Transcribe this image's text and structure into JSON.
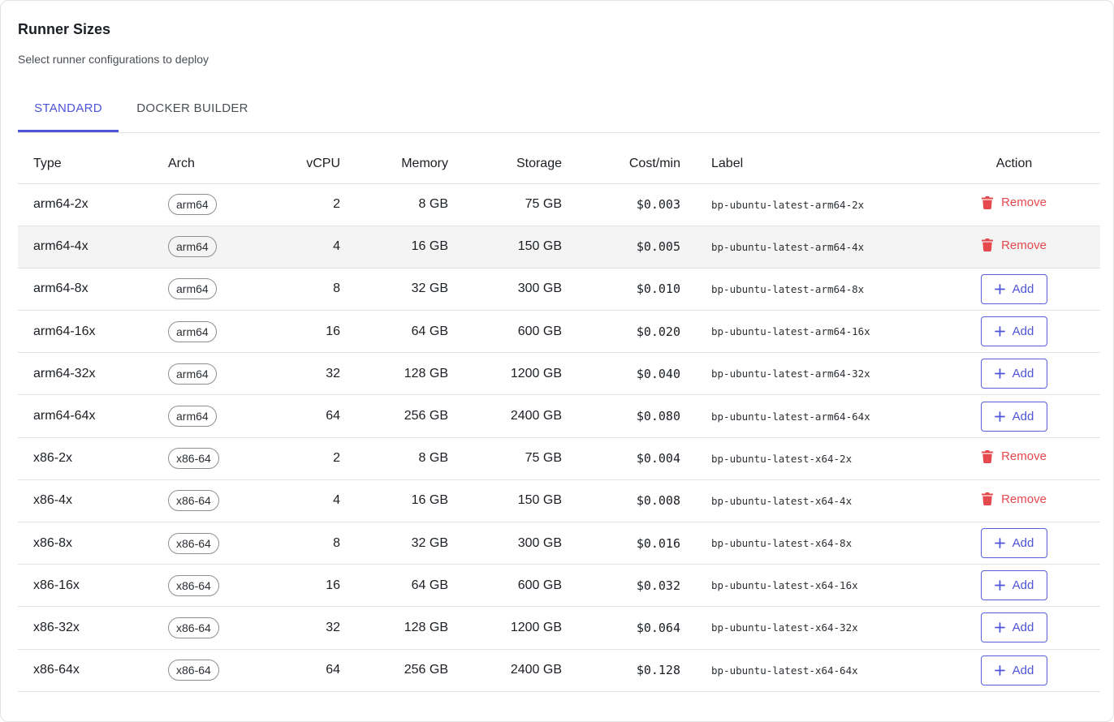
{
  "card": {
    "title": "Runner Sizes",
    "subtitle": "Select runner configurations to deploy"
  },
  "tabs": [
    {
      "label": "STANDARD",
      "active": true
    },
    {
      "label": "DOCKER BUILDER",
      "active": false
    }
  ],
  "table": {
    "headers": {
      "type": "Type",
      "arch": "Arch",
      "vcpu": "vCPU",
      "memory": "Memory",
      "storage": "Storage",
      "cost": "Cost/min",
      "label": "Label",
      "action": "Action"
    },
    "rows": [
      {
        "type": "arm64-2x",
        "arch": "arm64",
        "vcpu": "2",
        "memory": "8 GB",
        "storage": "75 GB",
        "cost": "$0.003",
        "label": "bp-ubuntu-latest-arm64-2x",
        "action": "Remove",
        "highlighted": false
      },
      {
        "type": "arm64-4x",
        "arch": "arm64",
        "vcpu": "4",
        "memory": "16 GB",
        "storage": "150 GB",
        "cost": "$0.005",
        "label": "bp-ubuntu-latest-arm64-4x",
        "action": "Remove",
        "highlighted": true
      },
      {
        "type": "arm64-8x",
        "arch": "arm64",
        "vcpu": "8",
        "memory": "32 GB",
        "storage": "300 GB",
        "cost": "$0.010",
        "label": "bp-ubuntu-latest-arm64-8x",
        "action": "Add",
        "highlighted": false
      },
      {
        "type": "arm64-16x",
        "arch": "arm64",
        "vcpu": "16",
        "memory": "64 GB",
        "storage": "600 GB",
        "cost": "$0.020",
        "label": "bp-ubuntu-latest-arm64-16x",
        "action": "Add",
        "highlighted": false
      },
      {
        "type": "arm64-32x",
        "arch": "arm64",
        "vcpu": "32",
        "memory": "128 GB",
        "storage": "1200 GB",
        "cost": "$0.040",
        "label": "bp-ubuntu-latest-arm64-32x",
        "action": "Add",
        "highlighted": false
      },
      {
        "type": "arm64-64x",
        "arch": "arm64",
        "vcpu": "64",
        "memory": "256 GB",
        "storage": "2400 GB",
        "cost": "$0.080",
        "label": "bp-ubuntu-latest-arm64-64x",
        "action": "Add",
        "highlighted": false
      },
      {
        "type": "x86-2x",
        "arch": "x86-64",
        "vcpu": "2",
        "memory": "8 GB",
        "storage": "75 GB",
        "cost": "$0.004",
        "label": "bp-ubuntu-latest-x64-2x",
        "action": "Remove",
        "highlighted": false
      },
      {
        "type": "x86-4x",
        "arch": "x86-64",
        "vcpu": "4",
        "memory": "16 GB",
        "storage": "150 GB",
        "cost": "$0.008",
        "label": "bp-ubuntu-latest-x64-4x",
        "action": "Remove",
        "highlighted": false
      },
      {
        "type": "x86-8x",
        "arch": "x86-64",
        "vcpu": "8",
        "memory": "32 GB",
        "storage": "300 GB",
        "cost": "$0.016",
        "label": "bp-ubuntu-latest-x64-8x",
        "action": "Add",
        "highlighted": false
      },
      {
        "type": "x86-16x",
        "arch": "x86-64",
        "vcpu": "16",
        "memory": "64 GB",
        "storage": "600 GB",
        "cost": "$0.032",
        "label": "bp-ubuntu-latest-x64-16x",
        "action": "Add",
        "highlighted": false
      },
      {
        "type": "x86-32x",
        "arch": "x86-64",
        "vcpu": "32",
        "memory": "128 GB",
        "storage": "1200 GB",
        "cost": "$0.064",
        "label": "bp-ubuntu-latest-x64-32x",
        "action": "Add",
        "highlighted": false
      },
      {
        "type": "x86-64x",
        "arch": "x86-64",
        "vcpu": "64",
        "memory": "256 GB",
        "storage": "2400 GB",
        "cost": "$0.128",
        "label": "bp-ubuntu-latest-x64-64x",
        "action": "Add",
        "highlighted": false
      }
    ]
  },
  "icons": {
    "remove": "trash-icon",
    "add": "plus-icon"
  },
  "colors": {
    "accent": "#4e54d8",
    "danger": "#e5484d",
    "row_highlight": "#f4f4f4"
  }
}
